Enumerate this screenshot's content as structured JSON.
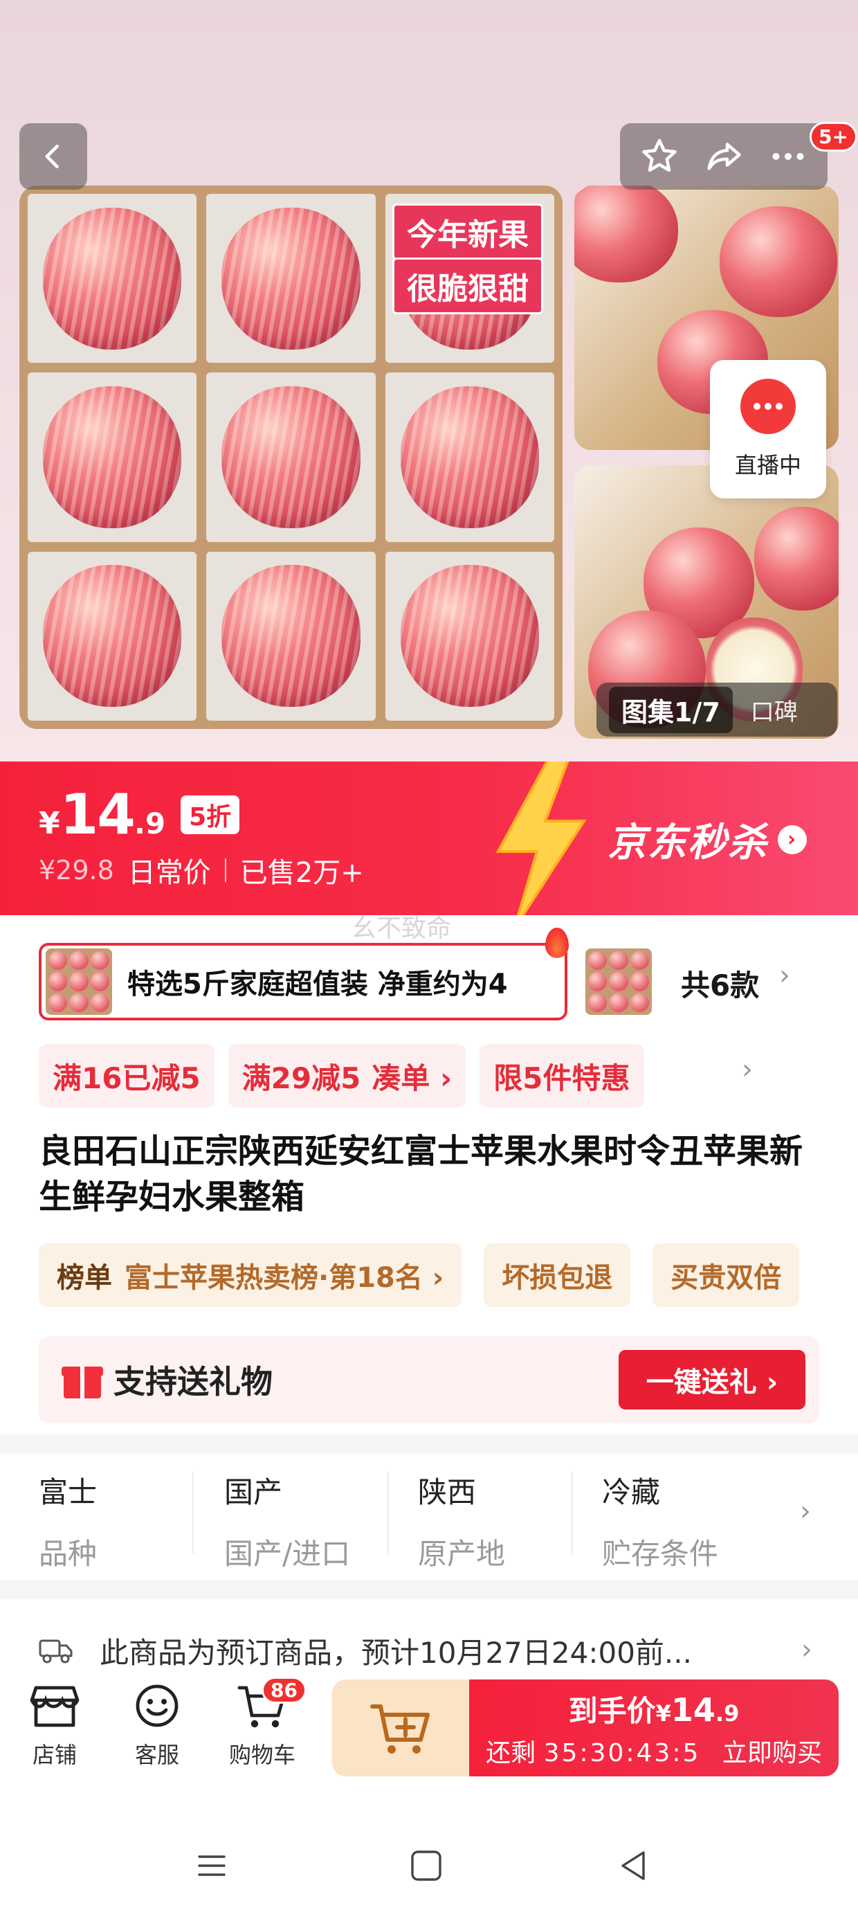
{
  "gallery": {
    "promo_line1": "今年新果",
    "promo_line2": "很脆狠甜",
    "counter_current": "图集1/7",
    "counter_extra": "口碑",
    "notification_badge": "5+",
    "live_label": "直播中"
  },
  "price": {
    "currency": "¥",
    "integer": "14",
    "decimal": ".9",
    "discount": "5折",
    "original": "¥29.8",
    "original_label": "日常价",
    "sold": "已售2万+",
    "campaign": "京东秒杀"
  },
  "watermark": "幺不致命",
  "variants": {
    "selected_name": "特选5斤家庭超值装 净重约为4",
    "count_label": "共6款"
  },
  "coupons": [
    {
      "label": "满16已减5"
    },
    {
      "label": "满29减5",
      "sub": "凑单 ›"
    },
    {
      "label": "限5件特惠"
    }
  ],
  "product": {
    "title": "良田石山正宗陕西延安红富士苹果水果时令丑苹果新生鲜孕妇水果整箱"
  },
  "ranking": {
    "head": "榜单",
    "text": "富士苹果热卖榜·第18名 ›",
    "chip2": "坏损包退",
    "chip3": "买贵双倍"
  },
  "gift": {
    "label": "支持送礼物",
    "button": "一键送礼 ›"
  },
  "specs": [
    {
      "value": "富士",
      "key": "品种"
    },
    {
      "value": "国产",
      "key": "国产/进口"
    },
    {
      "value": "陕西",
      "key": "原产地"
    },
    {
      "value": "冷藏",
      "key": "贮存条件"
    }
  ],
  "delivery": {
    "text": "此商品为预订商品，预计10月27日24:00前..."
  },
  "bottom_bar": {
    "shop": "店铺",
    "service": "客服",
    "cart": "购物车",
    "cart_count": "86",
    "buy_prefix": "到手价",
    "buy_currency": "¥",
    "buy_int": "14",
    "buy_dec": ".9",
    "countdown_label": "还剩",
    "countdown": "35:30:43:5",
    "buy_now": "立即购买"
  },
  "colors": {
    "accent_red": "#f5213b",
    "coupon_bg": "#fdeff0",
    "rank_bg": "#fbf1e4",
    "cart_btn_bg": "#fbe3c6"
  }
}
